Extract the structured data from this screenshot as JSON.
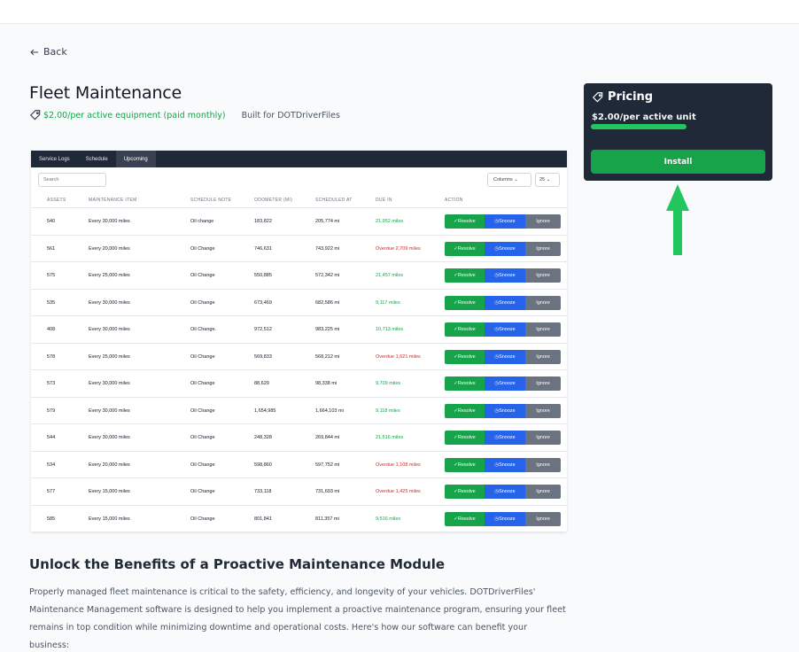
{
  "nav": {
    "back_label": "Back"
  },
  "app": {
    "title": "Fleet Maintenance",
    "price_line": "$2.00/per active equipment (paid monthly)",
    "built_for": "Built for DOTDriverFiles"
  },
  "screenshot": {
    "tabs": [
      "Service Logs",
      "Schedule",
      "Upcoming"
    ],
    "active_tab": "Upcoming",
    "search_placeholder": "Search",
    "columns_label": "Columns",
    "page_size": "25",
    "headers": [
      "ASSETS",
      "MAINTENANCE ITEM",
      "SCHEDULE NOTE",
      "ODOMETER (MI)",
      "SCHEDULED AT",
      "DUE IN",
      "ACTION"
    ],
    "actions": {
      "resolve": "Resolve",
      "snooze": "Snooze",
      "ignore": "Ignore"
    },
    "rows": [
      {
        "asset": "540",
        "item": "Every 30,000 miles",
        "note": "Oil change",
        "odometer": "183,822",
        "scheduled": "205,774 mi",
        "due": "21,952 miles",
        "overdue": false
      },
      {
        "asset": "561",
        "item": "Every 20,000 miles",
        "note": "Oil Change",
        "odometer": "746,631",
        "scheduled": "743,922 mi",
        "due": "Overdue 2,709 miles",
        "overdue": true
      },
      {
        "asset": "575",
        "item": "Every 25,000 miles",
        "note": "Oil Change",
        "odometer": "550,885",
        "scheduled": "572,342 mi",
        "due": "21,457 miles",
        "overdue": false
      },
      {
        "asset": "535",
        "item": "Every 30,000 miles",
        "note": "Oil Change",
        "odometer": "673,469",
        "scheduled": "682,586 mi",
        "due": "9,117 miles",
        "overdue": false
      },
      {
        "asset": "408",
        "item": "Every 30,000 miles",
        "note": "Oil Change.",
        "odometer": "972,512",
        "scheduled": "983,225 mi",
        "due": "10,713 miles",
        "overdue": false
      },
      {
        "asset": "578",
        "item": "Every 25,000 miles",
        "note": "Oil Change",
        "odometer": "569,833",
        "scheduled": "568,212 mi",
        "due": "Overdue 1,621 miles",
        "overdue": true
      },
      {
        "asset": "573",
        "item": "Every 30,000 miles",
        "note": "Oil Change",
        "odometer": "88,629",
        "scheduled": "98,338 mi",
        "due": "9,709 miles",
        "overdue": false
      },
      {
        "asset": "579",
        "item": "Every 30,000 miles",
        "note": "Oil Change",
        "odometer": "1,654,985",
        "scheduled": "1,664,103 mi",
        "due": "9,118 miles",
        "overdue": false
      },
      {
        "asset": "544",
        "item": "Every 30,000 miles",
        "note": "Oil Change",
        "odometer": "248,328",
        "scheduled": "269,844 mi",
        "due": "21,516 miles",
        "overdue": false
      },
      {
        "asset": "534",
        "item": "Every 20,000 miles",
        "note": "Oil Change",
        "odometer": "598,860",
        "scheduled": "597,752 mi",
        "due": "Overdue 1,108 miles",
        "overdue": true
      },
      {
        "asset": "577",
        "item": "Every 15,000 miles",
        "note": "Oil Change",
        "odometer": "733,118",
        "scheduled": "731,693 mi",
        "due": "Overdue 1,425 miles",
        "overdue": true
      },
      {
        "asset": "585",
        "item": "Every 15,000 miles",
        "note": "Oil Change",
        "odometer": "801,841",
        "scheduled": "811,357 mi",
        "due": "9,516 miles",
        "overdue": false
      }
    ]
  },
  "pricing": {
    "heading": "Pricing",
    "price": "$2.00/per active unit",
    "install_label": "Install"
  },
  "content": {
    "heading": "Unlock the Benefits of a Proactive Maintenance Module",
    "paragraph": "Properly managed fleet maintenance is critical to the safety, efficiency, and longevity of your vehicles. DOTDriverFiles' Maintenance Management software is designed to help you implement a proactive maintenance program, ensuring your fleet remains in top condition while minimizing downtime and operational costs. Here's how our software can benefit your business:"
  },
  "colors": {
    "accent_green": "#16a34a",
    "snooze_blue": "#2563eb",
    "overdue_red": "#dc2626",
    "card_dark": "#1f2937"
  },
  "icons": [
    "arrow-left-icon",
    "tag-icon",
    "up-arrow-annotation"
  ]
}
